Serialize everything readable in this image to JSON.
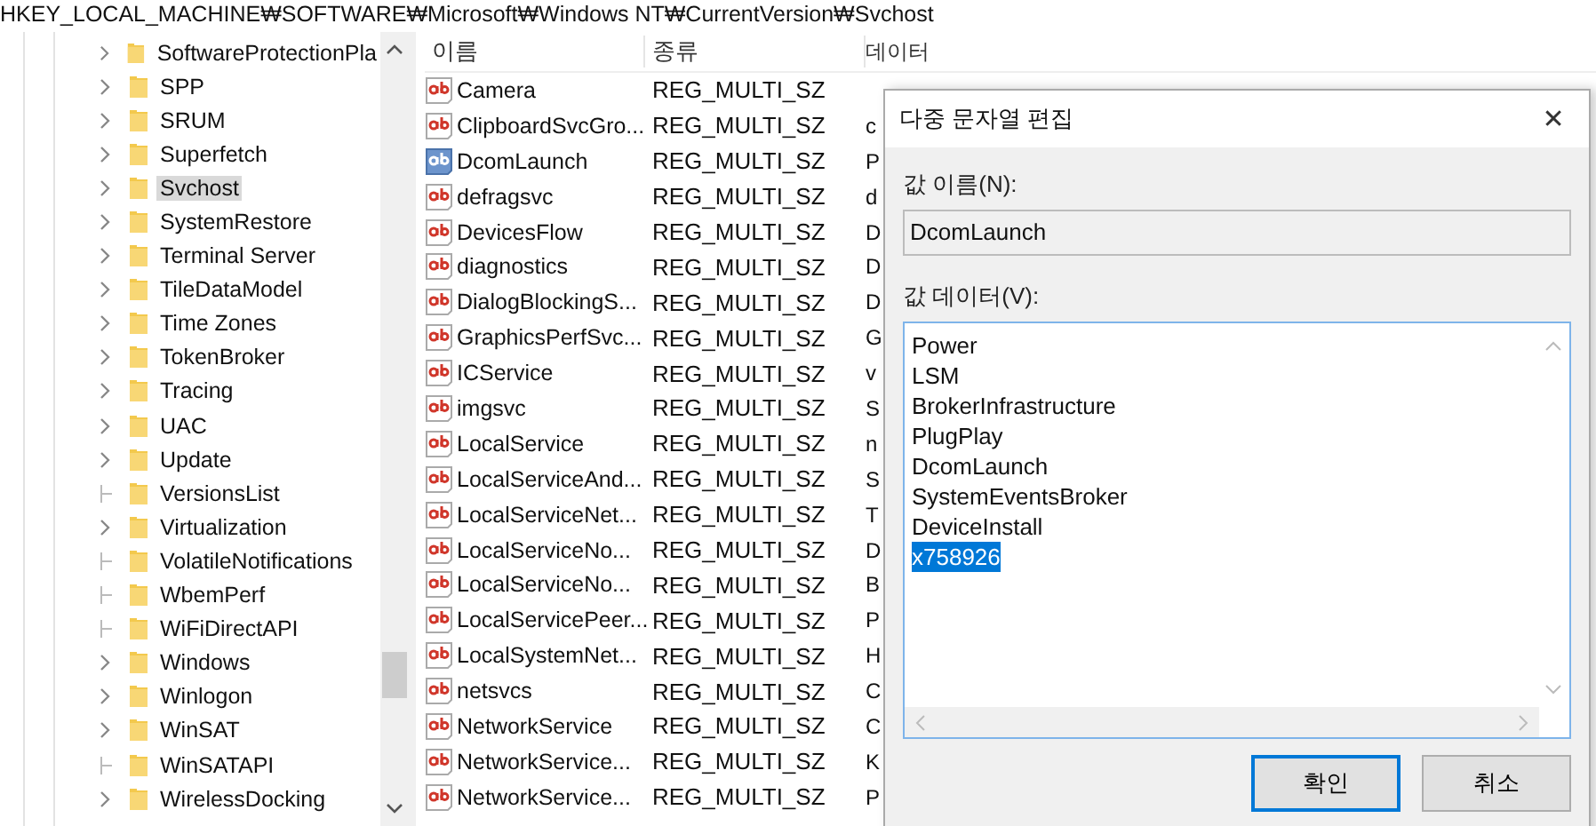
{
  "address_bar": {
    "path": "HKEY_LOCAL_MACHINE₩SOFTWARE₩Microsoft₩Windows NT₩CurrentVersion₩Svchost"
  },
  "tree": {
    "items": [
      {
        "label": "SoftwareProtectionPla",
        "expandable": true,
        "selected": false
      },
      {
        "label": "SPP",
        "expandable": true,
        "selected": false
      },
      {
        "label": "SRUM",
        "expandable": true,
        "selected": false
      },
      {
        "label": "Superfetch",
        "expandable": true,
        "selected": false
      },
      {
        "label": "Svchost",
        "expandable": true,
        "selected": true
      },
      {
        "label": "SystemRestore",
        "expandable": true,
        "selected": false
      },
      {
        "label": "Terminal Server",
        "expandable": true,
        "selected": false
      },
      {
        "label": "TileDataModel",
        "expandable": true,
        "selected": false
      },
      {
        "label": "Time Zones",
        "expandable": true,
        "selected": false
      },
      {
        "label": "TokenBroker",
        "expandable": true,
        "selected": false
      },
      {
        "label": "Tracing",
        "expandable": true,
        "selected": false
      },
      {
        "label": "UAC",
        "expandable": true,
        "selected": false
      },
      {
        "label": "Update",
        "expandable": true,
        "selected": false
      },
      {
        "label": "VersionsList",
        "expandable": false,
        "selected": false
      },
      {
        "label": "Virtualization",
        "expandable": true,
        "selected": false
      },
      {
        "label": "VolatileNotifications",
        "expandable": false,
        "selected": false
      },
      {
        "label": "WbemPerf",
        "expandable": false,
        "selected": false
      },
      {
        "label": "WiFiDirectAPI",
        "expandable": false,
        "selected": false
      },
      {
        "label": "Windows",
        "expandable": true,
        "selected": false
      },
      {
        "label": "Winlogon",
        "expandable": true,
        "selected": false
      },
      {
        "label": "WinSAT",
        "expandable": true,
        "selected": false
      },
      {
        "label": "WinSATAPI",
        "expandable": false,
        "selected": false
      },
      {
        "label": "WirelessDocking",
        "expandable": true,
        "selected": false
      }
    ]
  },
  "table": {
    "columns": [
      "이름",
      "종류",
      "데이터"
    ],
    "rows": [
      {
        "name": "Camera",
        "type": "REG_MULTI_SZ",
        "selected": false
      },
      {
        "name": "ClipboardSvcGro...",
        "type": "REG_MULTI_SZ",
        "data": "c",
        "selected": false
      },
      {
        "name": "DcomLaunch",
        "type": "REG_MULTI_SZ",
        "data": "P",
        "selected": true
      },
      {
        "name": "defragsvc",
        "type": "REG_MULTI_SZ",
        "data": "d",
        "selected": false
      },
      {
        "name": "DevicesFlow",
        "type": "REG_MULTI_SZ",
        "data": "D",
        "selected": false
      },
      {
        "name": "diagnostics",
        "type": "REG_MULTI_SZ",
        "data": "D",
        "selected": false
      },
      {
        "name": "DialogBlockingS...",
        "type": "REG_MULTI_SZ",
        "data": "D",
        "selected": false
      },
      {
        "name": "GraphicsPerfSvc...",
        "type": "REG_MULTI_SZ",
        "data": "G",
        "selected": false
      },
      {
        "name": "ICService",
        "type": "REG_MULTI_SZ",
        "data": "v",
        "selected": false
      },
      {
        "name": "imgsvc",
        "type": "REG_MULTI_SZ",
        "data": "S",
        "selected": false
      },
      {
        "name": "LocalService",
        "type": "REG_MULTI_SZ",
        "data": "n",
        "selected": false
      },
      {
        "name": "LocalServiceAnd...",
        "type": "REG_MULTI_SZ",
        "data": "S",
        "selected": false
      },
      {
        "name": "LocalServiceNet...",
        "type": "REG_MULTI_SZ",
        "data": "T",
        "selected": false
      },
      {
        "name": "LocalServiceNo...",
        "type": "REG_MULTI_SZ",
        "data": "D",
        "selected": false
      },
      {
        "name": "LocalServiceNo...",
        "type": "REG_MULTI_SZ",
        "data": "B",
        "selected": false
      },
      {
        "name": "LocalServicePeer...",
        "type": "REG_MULTI_SZ",
        "data": "P",
        "selected": false
      },
      {
        "name": "LocalSystemNet...",
        "type": "REG_MULTI_SZ",
        "data": "H",
        "selected": false
      },
      {
        "name": "netsvcs",
        "type": "REG_MULTI_SZ",
        "data": "C",
        "selected": false
      },
      {
        "name": "NetworkService",
        "type": "REG_MULTI_SZ",
        "data": "C",
        "selected": false
      },
      {
        "name": "NetworkService...",
        "type": "REG_MULTI_SZ",
        "data": "K",
        "selected": false
      },
      {
        "name": "NetworkService...",
        "type": "REG_MULTI_SZ",
        "data": "P",
        "selected": false
      }
    ]
  },
  "dialog": {
    "title": "다중 문자열 편집",
    "close": "✕",
    "name_label": "값 이름(N):",
    "name_value": "DcomLaunch",
    "data_label": "값 데이터(V):",
    "data_lines": [
      {
        "text": "Power",
        "selected": false
      },
      {
        "text": "LSM",
        "selected": false
      },
      {
        "text": "BrokerInfrastructure",
        "selected": false
      },
      {
        "text": "PlugPlay",
        "selected": false
      },
      {
        "text": "DcomLaunch",
        "selected": false
      },
      {
        "text": "SystemEventsBroker",
        "selected": false
      },
      {
        "text": "DeviceInstall",
        "selected": false
      },
      {
        "text": "x758926",
        "selected": true
      }
    ],
    "buttons": [
      {
        "label": "확인",
        "default": true
      },
      {
        "label": "취소",
        "default": false
      }
    ]
  }
}
